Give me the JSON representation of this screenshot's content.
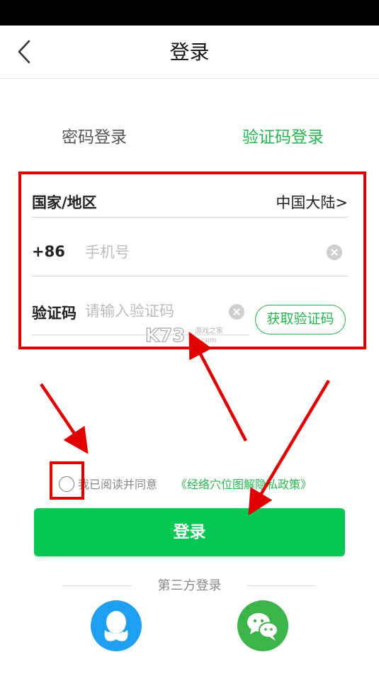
{
  "header": {
    "title": "登录"
  },
  "tabs": {
    "password": "密码登录",
    "code": "验证码登录"
  },
  "form": {
    "region_label": "国家/地区",
    "region_value": "中国大陆>",
    "country_code": "+86",
    "phone_placeholder": "手机号",
    "code_label": "验证码",
    "code_placeholder": "请输入验证码",
    "get_code_label": "获取验证码"
  },
  "watermark": {
    "text": "K73",
    "cn": "游戏之家",
    "domain": ".com"
  },
  "agreement": {
    "prefix": "我已阅读并同意",
    "link": "《经络穴位图解隐私政策》"
  },
  "login_button": "登录",
  "third_party": {
    "label": "第三方登录",
    "providers": [
      "qq-icon",
      "wechat-icon"
    ]
  },
  "colors": {
    "accent_green": "#22b84d",
    "button_green": "#07c755",
    "annotation_red": "#e30000",
    "qq_blue": "#1e9ff2",
    "wechat_green": "#3bb54a"
  }
}
